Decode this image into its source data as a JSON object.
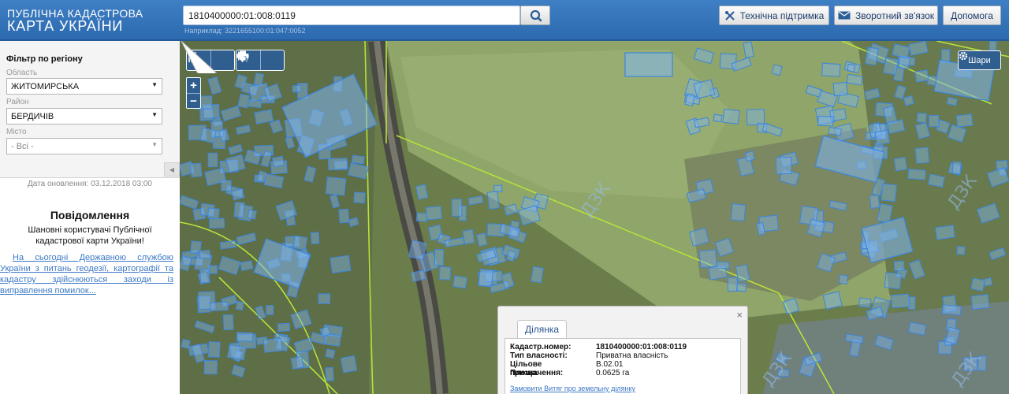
{
  "header": {
    "logo_line1": "ПУБЛІЧНА КАДАСТРОВА",
    "logo_line2": "КАРТА УКРАЇНИ",
    "search_value": "1810400000:01:008:0119",
    "search_hint": "Наприклад: 3221655100:01:047:0052",
    "support_label": "Технічна підтримка",
    "feedback_label": "Зворотний зв'язок",
    "help_label": "Допомога"
  },
  "filter": {
    "title": "Фільтр по регіону",
    "region_label": "Область",
    "region_value": "ЖИТОМИРСЬКА",
    "district_label": "Район",
    "district_value": "БЕРДИЧІВ",
    "city_label": "Місто",
    "city_value": "- Всі -"
  },
  "update_date": "Дата оновлення: 03.12.2018 03:00",
  "news": {
    "title": "Повідомлення",
    "greeting": "Шановні користувачі Публічної кадастрової карти України!",
    "link": "На сьогодні Державною службою України з питань геодезії, картографії та кадастру здійснюються заходи із виправлення помилок..."
  },
  "map": {
    "layers_label": "Шари",
    "watermark": "ДЗК",
    "colors": {
      "parcel_fill": "#7fb6f0",
      "parcel_stroke": "#3d86dd",
      "boundary_line": "#b6e23a",
      "panel_blue": "#2f5e8f"
    }
  },
  "popup": {
    "tab_label": "Ділянка",
    "rows": [
      {
        "key": "Кадастр.номер:",
        "value": "1810400000:01:008:0119",
        "bold": true
      },
      {
        "key": "Тип власності:",
        "value": "Приватна власність",
        "bold": false
      },
      {
        "key": "Цільове призначення:",
        "value": "В.02.01",
        "bold": false
      },
      {
        "key": "Площа:",
        "value": "0.0625 га",
        "bold": false
      }
    ],
    "order_link": "Замовити Витяг про земельну ділянку"
  }
}
